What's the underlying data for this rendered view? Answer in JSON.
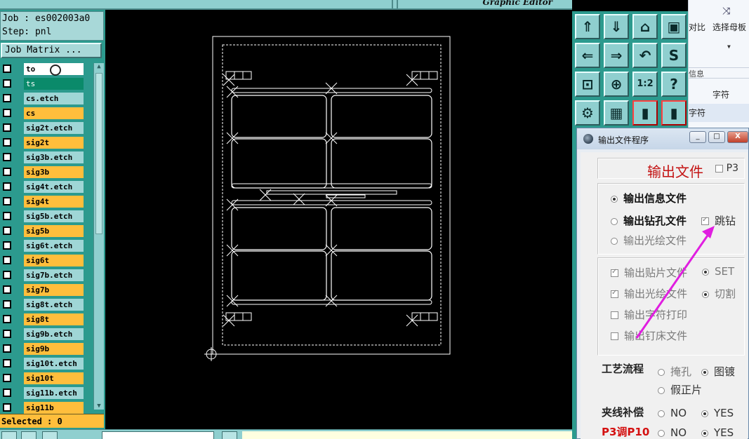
{
  "window": {
    "graphic_editor_title": "Graphic Editor"
  },
  "job": {
    "job_line": "Job : es002003a0",
    "step_line": "Step: pnl",
    "matrix_button": "Job Matrix ..."
  },
  "layers": [
    {
      "name": "to",
      "color": "white"
    },
    {
      "name": "ts",
      "color": "green"
    },
    {
      "name": "cs.etch",
      "color": "blue"
    },
    {
      "name": "cs",
      "color": "orange"
    },
    {
      "name": "sig2t.etch",
      "color": "blue"
    },
    {
      "name": "sig2t",
      "color": "orange"
    },
    {
      "name": "sig3b.etch",
      "color": "blue"
    },
    {
      "name": "sig3b",
      "color": "orange"
    },
    {
      "name": "sig4t.etch",
      "color": "blue"
    },
    {
      "name": "sig4t",
      "color": "orange"
    },
    {
      "name": "sig5b.etch",
      "color": "blue"
    },
    {
      "name": "sig5b",
      "color": "orange"
    },
    {
      "name": "sig6t.etch",
      "color": "blue"
    },
    {
      "name": "sig6t",
      "color": "orange"
    },
    {
      "name": "sig7b.etch",
      "color": "blue"
    },
    {
      "name": "sig7b",
      "color": "orange"
    },
    {
      "name": "sig8t.etch",
      "color": "blue"
    },
    {
      "name": "sig8t",
      "color": "orange"
    },
    {
      "name": "sig9b.etch",
      "color": "blue"
    },
    {
      "name": "sig9b",
      "color": "orange"
    },
    {
      "name": "sig10t.etch",
      "color": "blue"
    },
    {
      "name": "sig10t",
      "color": "orange"
    },
    {
      "name": "sig11b.etch",
      "color": "blue"
    },
    {
      "name": "sig11b",
      "color": "orange"
    }
  ],
  "selected_text": "Selected : 0",
  "ribbon": {
    "compare": "对比",
    "choose_master": "选择母板",
    "info": "信息",
    "char_a": "字符",
    "char_b": "字符"
  },
  "dialog": {
    "title": "输出文件程序",
    "min": "_",
    "max": "□",
    "close": "X",
    "header": "输出文件",
    "p3": "P3",
    "opt_info": "输出信息文件",
    "opt_drill": "输出钻孔文件",
    "skip_drill": "跳钻",
    "opt_photo": "输出光绘文件",
    "chk_smt": "输出贴片文件",
    "set": "SET",
    "chk_photo": "输出光绘文件",
    "cut": "切割",
    "chk_print": "输出字符打印",
    "chk_bed": "输出钉床文件",
    "process_label": "工艺流程",
    "tent": "掩孔",
    "pattern": "图镀",
    "fake": "假正片",
    "clamp_label": "夹线补偿",
    "no1": "NO",
    "yes1": "YES",
    "p3p10_label": "P3调P10",
    "no2": "NO",
    "yes2": "YES"
  }
}
